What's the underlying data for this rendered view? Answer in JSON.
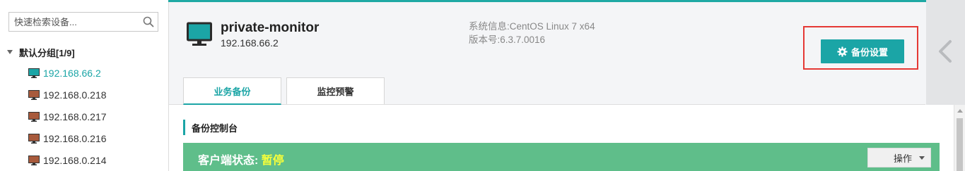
{
  "sidebar": {
    "search_placeholder": "快速检索设备...",
    "group_label": "默认分组[1/9]",
    "devices": [
      {
        "ip": "192.168.66.2",
        "status": "online"
      },
      {
        "ip": "192.168.0.218",
        "status": "offline"
      },
      {
        "ip": "192.168.0.217",
        "status": "offline"
      },
      {
        "ip": "192.168.0.216",
        "status": "offline"
      },
      {
        "ip": "192.168.0.214",
        "status": "offline"
      }
    ]
  },
  "device": {
    "name": "private-monitor",
    "ip": "192.168.66.2",
    "system_info": "系统信息:CentOS Linux 7 x64",
    "version": "版本号:6.3.7.0016"
  },
  "toolbar": {
    "backup_settings_label": "备份设置"
  },
  "tabs": [
    {
      "label": "业务备份",
      "active": true
    },
    {
      "label": "监控预警",
      "active": false
    }
  ],
  "console": {
    "title": "备份控制台",
    "status_label": "客户端状态:",
    "status_value": "暂停",
    "operation_label": "操作"
  },
  "colors": {
    "accent": "#1ba5a6",
    "status_bar": "#5fbe8a",
    "status_value": "#f7ff3a",
    "online_monitor": "#1ba5a6",
    "offline_monitor": "#a85a3c",
    "highlight_box": "#e53935"
  },
  "icons": {
    "search": "search-icon",
    "monitor": "monitor-icon",
    "gear": "gear-icon",
    "collapse": "chevron-left-icon"
  }
}
